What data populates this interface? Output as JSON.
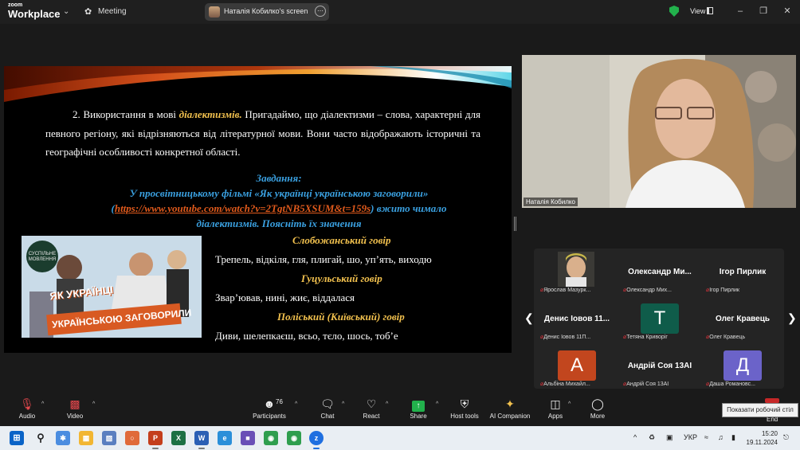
{
  "titlebar": {
    "logo_top": "zoom",
    "logo_bottom": "Workplace",
    "meeting_label": "Meeting",
    "share_label": "Наталія Кобилко's screen",
    "view_label": "View"
  },
  "slide": {
    "para_prefix": "2. Використання в мові ",
    "para_highlight": "діалектизмів.",
    "para_rest": " Пригадаймо, що діалектизми – слова, характерні для певного регіону, які відрізняються від літературної мови. Вони часто відображають історичні та географічні особливості конкретної області.",
    "task_title": "Завдання:",
    "task_line1": "У просвітницькому фільмі «Як українці українською заговорили»",
    "task_open_paren": "(",
    "task_link": "https://www.youtube.com/watch?v=2TgtNB5XSUM&t=159s",
    "task_line2_rest": ") вжито чимало",
    "task_line3": "діалектизмів. Поясніть їх значення",
    "film_logo": "СУСПІЛЬНЕ МОВЛЕННЯ",
    "film_title_1": "ЯК УКРАЇНЦІ",
    "film_title_2": "УКРАЇНСЬКОЮ ЗАГОВОРИЛИ",
    "dialects": [
      {
        "heading": "Слобожанський говір",
        "text": "Трепель, відкіля, гля, плигай, шо, уп’ять, виходю"
      },
      {
        "heading": "Гуцульський говір",
        "text": "Звар’ював, нині, жиє, віддалася"
      },
      {
        "heading": "Поліський (Київський) говір",
        "text": "Диви, шелепкаєш, всьо, тєло, шось, тоб’е"
      }
    ]
  },
  "speaker": {
    "name": "Наталія Кобилко"
  },
  "gallery": {
    "tiles": [
      {
        "big": "",
        "mini": "Ярослав Мазурк...",
        "kind": "video",
        "color": ""
      },
      {
        "big": "Олександр Ми...",
        "mini": "Олександр Мих...",
        "kind": "name",
        "color": ""
      },
      {
        "big": "Ігор Пирлик",
        "mini": "Ігор Пирлик",
        "kind": "name",
        "color": ""
      },
      {
        "big": "Денис Іовов 11...",
        "mini": "Денис Іовов 11П...",
        "kind": "name",
        "color": ""
      },
      {
        "big": "T",
        "mini": "Тетяна Криворіг",
        "kind": "letter",
        "color": "#0f5c4a"
      },
      {
        "big": "Олег Кравець",
        "mini": "Олег Кравець",
        "kind": "name",
        "color": ""
      },
      {
        "big": "А",
        "mini": "Альбіна Михайл...",
        "kind": "letter",
        "color": "#c2461e"
      },
      {
        "big": "Андрій Соя 13АІ",
        "mini": "Андрій Соя 13АІ",
        "kind": "name",
        "color": ""
      },
      {
        "big": "Д",
        "mini": "Даша Романовс...",
        "kind": "letter",
        "color": "#6b63c9"
      }
    ],
    "prev": "❮",
    "next": "❯"
  },
  "toolbar": {
    "audio": "Audio",
    "video": "Video",
    "participants": "Participants",
    "participants_count": "76",
    "chat": "Chat",
    "react": "React",
    "share": "Share",
    "host_tools": "Host tools",
    "ai_companion": "AI Companion",
    "apps": "Apps",
    "more": "More",
    "end": "End",
    "tooltip": "Показати робочий стіл"
  },
  "taskbar": {
    "lang": "УКР",
    "time": "15:20",
    "date": "19.11.2024"
  }
}
